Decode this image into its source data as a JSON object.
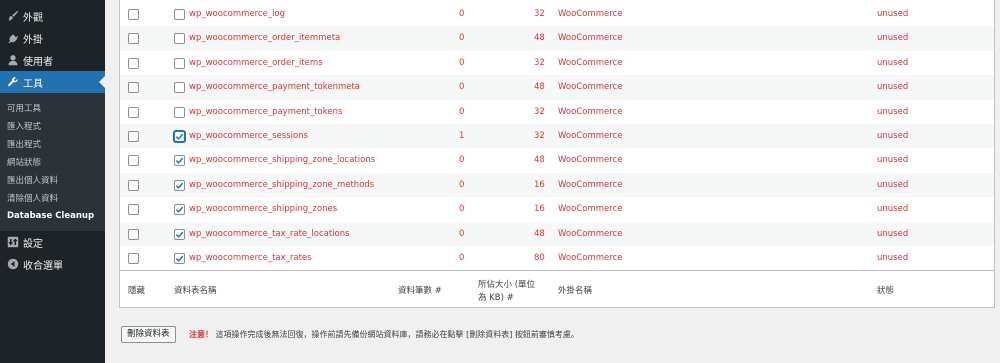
{
  "sidebar": {
    "items": [
      {
        "label": "外觀",
        "icon": "brush-icon"
      },
      {
        "label": "外掛",
        "icon": "plug-icon"
      },
      {
        "label": "使用者",
        "icon": "user-icon"
      },
      {
        "label": "工具",
        "icon": "wrench-icon",
        "active": true
      },
      {
        "label": "設定",
        "icon": "settings-icon"
      },
      {
        "label": "收合選單",
        "icon": "collapse-icon"
      }
    ],
    "submenu": [
      "可用工具",
      "匯入程式",
      "匯出程式",
      "網站狀態",
      "匯出個人資料",
      "清除個人資料",
      "Database Cleanup"
    ]
  },
  "table": {
    "rows": [
      {
        "name": "wp_woocommerce_log",
        "rows": "0",
        "size": "32",
        "plugin": "WooCommerce",
        "status": "unused",
        "checked": false
      },
      {
        "name": "wp_woocommerce_order_itemmeta",
        "rows": "0",
        "size": "48",
        "plugin": "WooCommerce",
        "status": "unused",
        "checked": false
      },
      {
        "name": "wp_woocommerce_order_items",
        "rows": "0",
        "size": "32",
        "plugin": "WooCommerce",
        "status": "unused",
        "checked": false
      },
      {
        "name": "wp_woocommerce_payment_tokenmeta",
        "rows": "0",
        "size": "48",
        "plugin": "WooCommerce",
        "status": "unused",
        "checked": false
      },
      {
        "name": "wp_woocommerce_payment_tokens",
        "rows": "0",
        "size": "32",
        "plugin": "WooCommerce",
        "status": "unused",
        "checked": false
      },
      {
        "name": "wp_woocommerce_sessions",
        "rows": "1",
        "size": "32",
        "plugin": "WooCommerce",
        "status": "unused",
        "checked": true
      },
      {
        "name": "wp_woocommerce_shipping_zone_locations",
        "rows": "0",
        "size": "48",
        "plugin": "WooCommerce",
        "status": "unused",
        "checked": true
      },
      {
        "name": "wp_woocommerce_shipping_zone_methods",
        "rows": "0",
        "size": "16",
        "plugin": "WooCommerce",
        "status": "unused",
        "checked": true
      },
      {
        "name": "wp_woocommerce_shipping_zones",
        "rows": "0",
        "size": "16",
        "plugin": "WooCommerce",
        "status": "unused",
        "checked": true
      },
      {
        "name": "wp_woocommerce_tax_rate_locations",
        "rows": "0",
        "size": "48",
        "plugin": "WooCommerce",
        "status": "unused",
        "checked": true
      },
      {
        "name": "wp_woocommerce_tax_rates",
        "rows": "0",
        "size": "80",
        "plugin": "WooCommerce",
        "status": "unused",
        "checked": true
      }
    ],
    "footer": {
      "hide": "隱藏",
      "name": "資料表名稱",
      "rows": "資料筆數 #",
      "size_line1": "所佔大小 (單位",
      "size_line2": "為 KB) #",
      "plugin": "外掛名稱",
      "status": "狀態"
    }
  },
  "delete_button": "刪除資料表",
  "notice": {
    "label": "注意！",
    "text": "這項操作完成後無法回復，操作前請先備份網站資料庫，請務必在點擊 [刪除資料表] 按鈕前審慎考慮。"
  },
  "colors": {
    "accent": "#2271b1",
    "danger": "#d63638",
    "sidebar": "#1d2327"
  }
}
